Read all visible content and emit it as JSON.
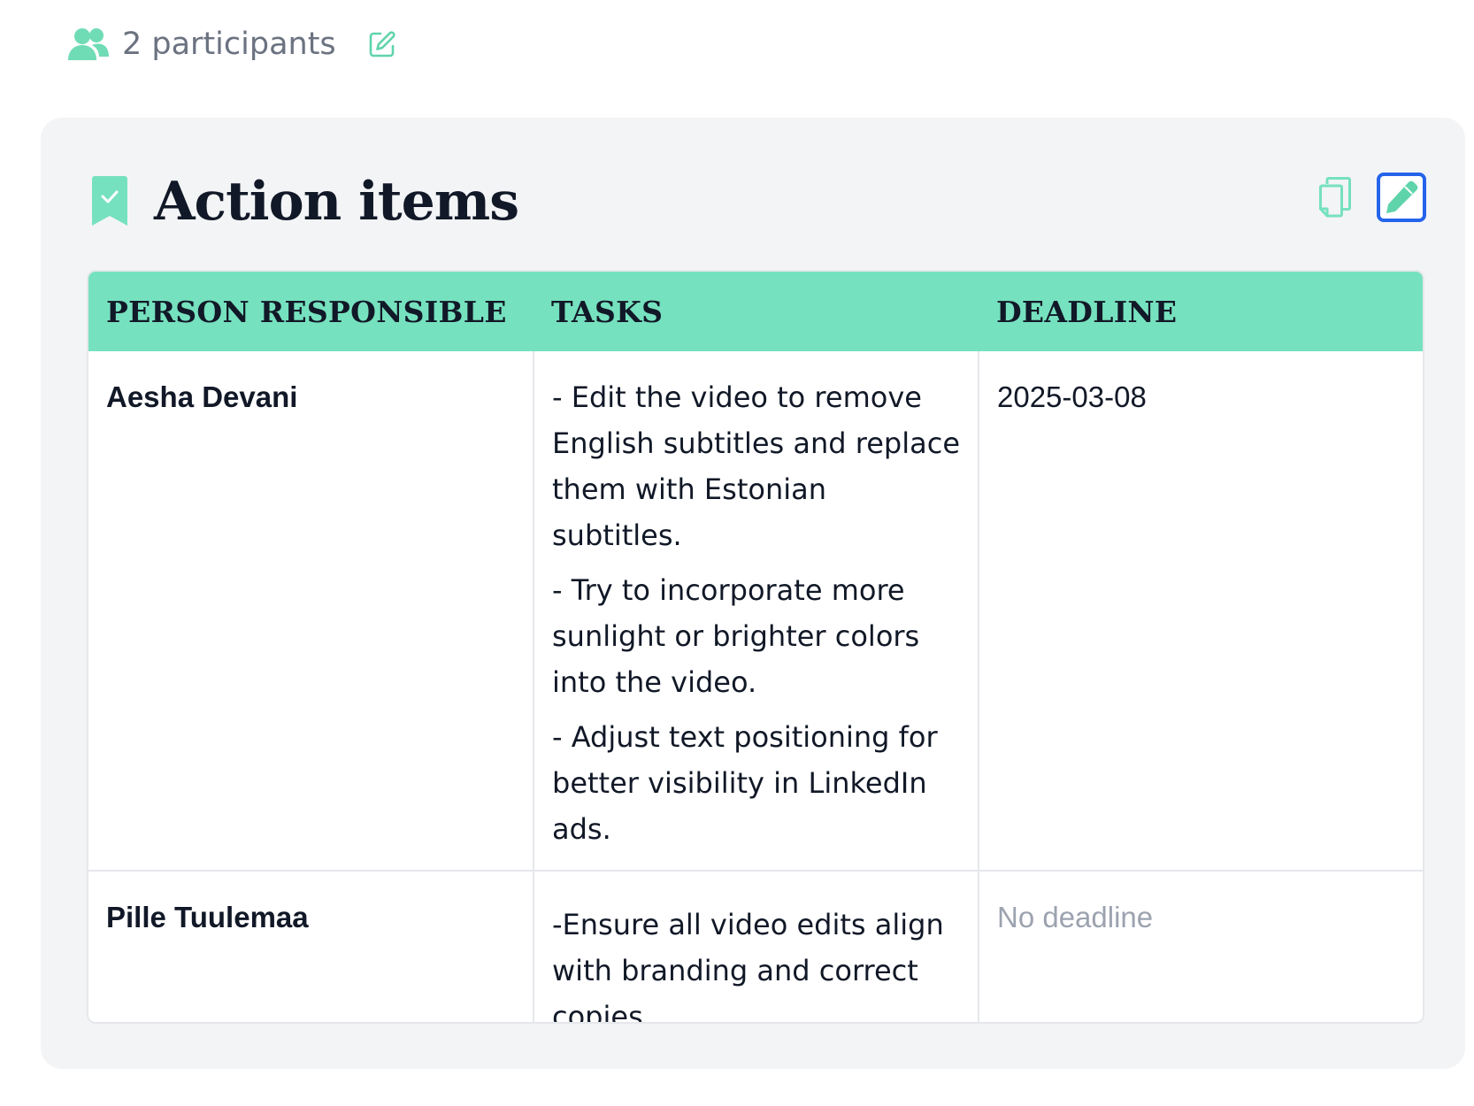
{
  "participants": {
    "icon": "people-icon",
    "label": "2 participants",
    "edit_icon": "edit-icon"
  },
  "action_items": {
    "icon": "bookmark-check-icon",
    "title": "Action items",
    "actions": {
      "copy_icon": "copy-icon",
      "edit_icon": "pencil-icon"
    },
    "columns": [
      "PERSON RESPONSIBLE",
      "TASKS",
      "DEADLINE"
    ],
    "rows": [
      {
        "person": "Aesha Devani",
        "tasks": [
          "- Edit the video to remove English subtitles and replace them with Estonian subtitles.",
          "- Try to incorporate more sunlight or brighter colors into the video.",
          "- Adjust text positioning for better visibility in LinkedIn ads."
        ],
        "deadline": "2025-03-08"
      },
      {
        "person": "Pille Tuulemaa",
        "tasks": [
          "-Ensure all video edits align with branding and correct copies."
        ],
        "deadline": "No deadline"
      }
    ]
  },
  "colors": {
    "accent": "#76e1be",
    "icon_green": "#5fd4ab",
    "edit_border": "#2563eb",
    "panel_bg": "#f3f4f6",
    "muted_text": "#9ca3af"
  }
}
